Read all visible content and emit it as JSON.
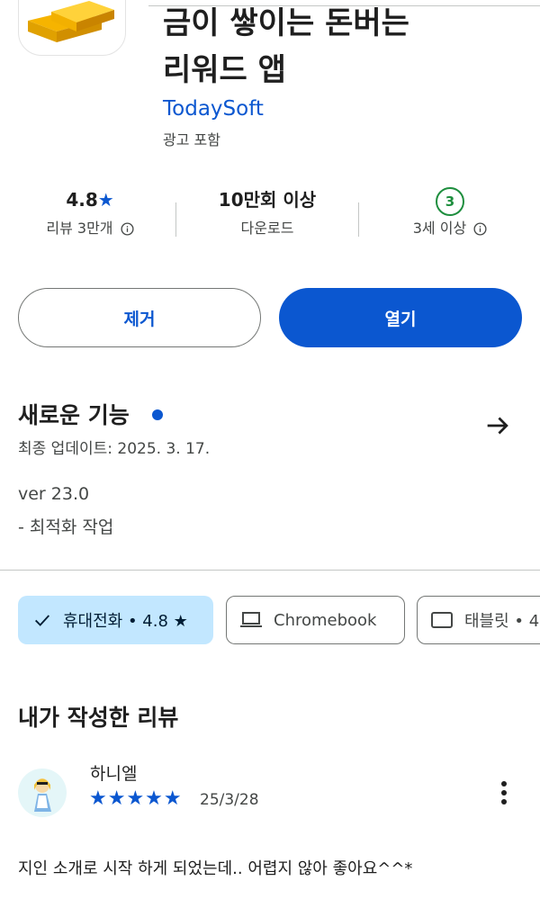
{
  "app": {
    "title_line1": "금이 쌓이는 돈버는",
    "title_line2": "리워드 앱",
    "developer": "TodaySoft",
    "ads_label": "광고 포함",
    "icon": "gold-bars-icon"
  },
  "stats": {
    "rating_value": "4.8",
    "rating_label": "리뷰 3만개",
    "downloads_value": "10만회 이상",
    "downloads_label": "다운로드",
    "age_badge": "3",
    "age_label": "3세 이상"
  },
  "buttons": {
    "remove": "제거",
    "open": "열기"
  },
  "whats_new": {
    "title": "새로운 기능",
    "updated": "최종 업데이트: 2025. 3. 17.",
    "version": "ver 23.0",
    "note": "- 최적화 작업"
  },
  "device_chips": {
    "phone": "휴대전화 • 4.8 ★",
    "chromebook": "Chromebook",
    "tablet": "태블릿 • 4"
  },
  "my_review": {
    "title": "내가 작성한 리뷰",
    "reviewer": "하니엘",
    "stars": "★★★★★",
    "rating": 5,
    "date": "25/3/28",
    "text": "지인 소개로 시작 하게 되었는데.. 어렵지 않아 좋아요^^*"
  },
  "colors": {
    "accent": "#0b57d0",
    "chip_selected": "#c2e7ff",
    "age_green": "#1e8e3e"
  }
}
